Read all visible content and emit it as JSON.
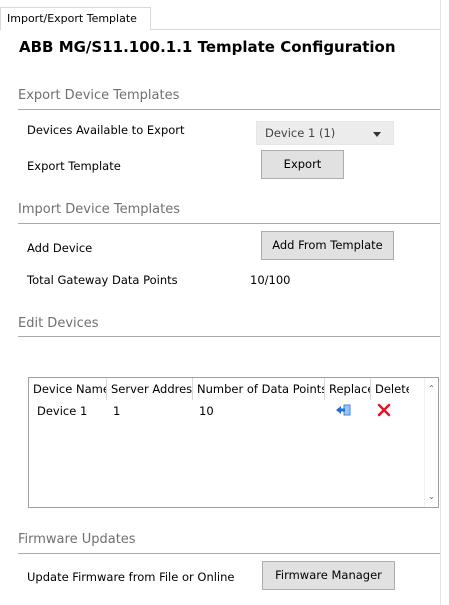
{
  "tab": {
    "label": "Import/Export Template"
  },
  "title": "ABB MG/S11.100.1.1 Template Configuration",
  "export_section": {
    "header": "Export Device Templates",
    "devices_label": "Devices Available to Export",
    "devices_selected": "Device 1 (1)",
    "export_label": "Export Template",
    "export_button": "Export"
  },
  "import_section": {
    "header": "Import Device Templates",
    "add_label": "Add Device",
    "add_button": "Add From Template",
    "points_label": "Total Gateway Data Points",
    "points_value": "10/100"
  },
  "edit_section": {
    "header": "Edit Devices",
    "columns": [
      "Device Name",
      "Server Address",
      "Number of Data Points",
      "Replace",
      "Delete"
    ],
    "rows": [
      {
        "device_name": "Device 1",
        "server_address": "1",
        "data_points": "10"
      }
    ]
  },
  "firmware_section": {
    "header": "Firmware Updates",
    "update_label": "Update Firmware from File or Online",
    "manager_button": "Firmware Manager"
  },
  "colors": {
    "section_header": "#707070",
    "button_bg": "#e1e1e1",
    "replace_icon": "#1e6fd9",
    "delete_icon": "#e81123"
  },
  "icons": {
    "replace": "replace-icon",
    "delete": "delete-icon",
    "dropdown": "chevron-down-icon"
  }
}
